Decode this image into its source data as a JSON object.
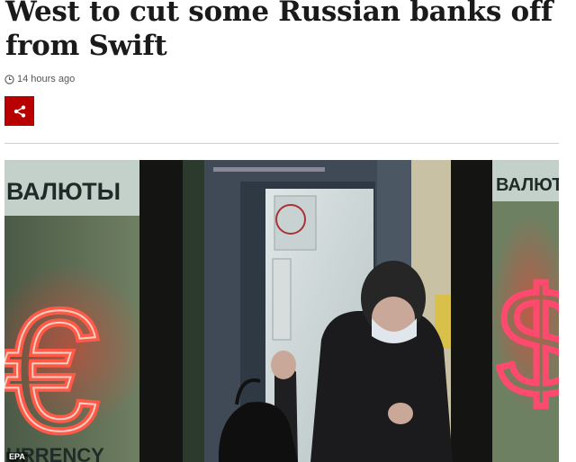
{
  "article": {
    "headline": "West to cut some Russian banks off from Swift",
    "timestamp": "14 hours ago"
  },
  "share": {
    "icon": "share-icon",
    "color": "#b80000"
  },
  "image": {
    "sign_left": "ВАЛЮТЫ",
    "sign_right": "ВАЛЮТЫ",
    "currency_word": "URRENCY",
    "euro_symbol": "€",
    "dollar_symbol": "$",
    "credit": "EPA"
  }
}
